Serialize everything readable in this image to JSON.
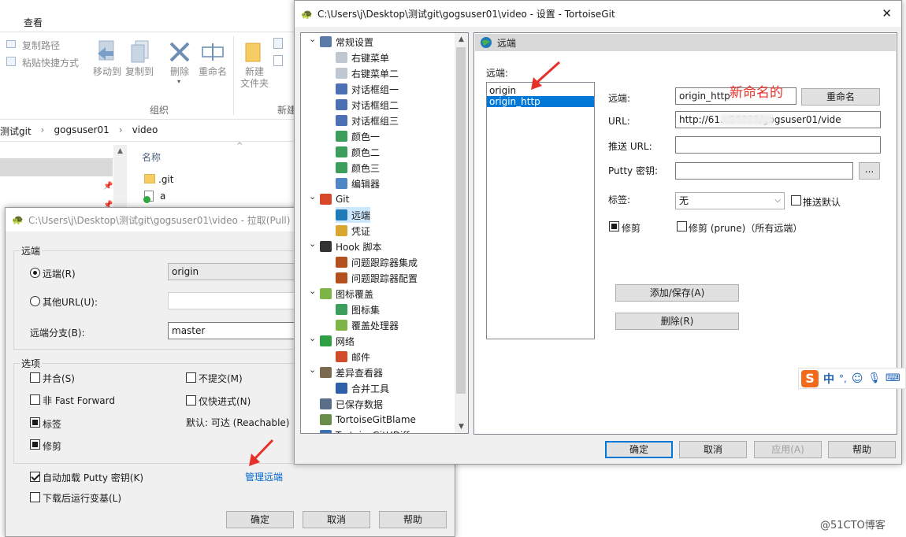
{
  "explorer": {
    "view_tab": "查看",
    "copy_path": "复制路径",
    "paste_shortcut": "粘贴快捷方式",
    "move_to": "移动到",
    "copy_to": "复制到",
    "delete": "删除",
    "rename": "重命名",
    "new_folder": "新建\n文件夹",
    "organize_group": "组织",
    "new_group": "新建",
    "breadcrumb": [
      "测试git",
      "gogsuser01",
      "video"
    ],
    "column_name": "名称",
    "files": [
      ".git",
      "a"
    ]
  },
  "pull_dialog": {
    "title": "C:\\Users\\j\\Desktop\\测试git\\gogsuser01\\video - 拉取(Pull) -",
    "remote_group": "远端",
    "remote_radio": "远端(R)",
    "remote_value": "origin",
    "other_url_radio": "其他URL(U):",
    "other_url_value": "",
    "remote_branch_label": "远端分支(B):",
    "remote_branch_value": "master",
    "options_group": "选项",
    "merge": "并合(S)",
    "no_commit": "不提交(M)",
    "non_ff": "非 Fast Forward",
    "ff_only": "仅快进式(N)",
    "tags": "标签",
    "default_reachable": "默认: 可达 (Reachable)",
    "prune": "修剪",
    "autoload_putty": "自动加载 Putty 密钥(K)",
    "manage_remotes": "管理远端",
    "launch_rebase": "下载后运行变基(L)",
    "ok": "确定",
    "cancel": "取消",
    "help": "帮助"
  },
  "settings_dialog": {
    "title": "C:\\Users\\j\\Desktop\\测试git\\gogsuser01\\video - 设置 - TortoiseGit",
    "close_glyph": "✕",
    "tree": [
      {
        "label": "常规设置",
        "level": 0,
        "icon": "wrench-icon"
      },
      {
        "label": "右键菜单",
        "level": 1,
        "icon": "gear-icon"
      },
      {
        "label": "右键菜单二",
        "level": 1,
        "icon": "gear-icon"
      },
      {
        "label": "对话框组一",
        "level": 1,
        "icon": "dialog-icon"
      },
      {
        "label": "对话框组二",
        "level": 1,
        "icon": "dialog-icon"
      },
      {
        "label": "对话框组三",
        "level": 1,
        "icon": "dialog-icon"
      },
      {
        "label": "颜色一",
        "level": 1,
        "icon": "color-icon"
      },
      {
        "label": "颜色二",
        "level": 1,
        "icon": "color-icon"
      },
      {
        "label": "颜色三",
        "level": 1,
        "icon": "color-icon"
      },
      {
        "label": "编辑器",
        "level": 1,
        "icon": "editor-icon"
      },
      {
        "label": "Git",
        "level": 0,
        "icon": "git-icon"
      },
      {
        "label": "远端",
        "level": 1,
        "icon": "globe-icon",
        "selected": true
      },
      {
        "label": "凭证",
        "level": 1,
        "icon": "credential-icon"
      },
      {
        "label": "Hook 脚本",
        "level": 0,
        "icon": "hook-icon"
      },
      {
        "label": "问题跟踪器集成",
        "level": 1,
        "icon": "bug-icon"
      },
      {
        "label": "问题跟踪器配置",
        "level": 1,
        "icon": "bug-icon"
      },
      {
        "label": "图标覆盖",
        "level": 0,
        "icon": "overlay-icon"
      },
      {
        "label": "图标集",
        "level": 1,
        "icon": "color-icon"
      },
      {
        "label": "覆盖处理器",
        "level": 1,
        "icon": "overlay-icon"
      },
      {
        "label": "网络",
        "level": 0,
        "icon": "network-icon"
      },
      {
        "label": "邮件",
        "level": 1,
        "icon": "mail-icon"
      },
      {
        "label": "差异查看器",
        "level": 0,
        "icon": "diff-icon"
      },
      {
        "label": "合并工具",
        "level": 1,
        "icon": "merge-icon"
      },
      {
        "label": "已保存数据",
        "level": 0,
        "icon": "saved-data-icon"
      },
      {
        "label": "TortoiseGitBlame",
        "level": 0,
        "icon": "blame-icon"
      },
      {
        "label": "TortoiseGitUDiff",
        "level": 0,
        "icon": "udiff-icon"
      }
    ],
    "page_header": "远端",
    "remotes_label": "远端:",
    "remotes": [
      "origin",
      "origin_http"
    ],
    "selected_remote": "origin_http",
    "remote_field_label": "远端:",
    "remote_field_value": "origin_http",
    "rename_button": "重命名",
    "url_label": "URL:",
    "url_value": "http://61.          :20891/gogsuser01/vide",
    "push_url_label": "推送 URL:",
    "push_url_value": "",
    "putty_label": "Putty 密钥:",
    "putty_value": "",
    "browse": "...",
    "tags_label": "标签:",
    "tags_value": "无",
    "push_default": "推送默认",
    "prune_label": "修剪",
    "prune_all": "修剪 (prune)（所有远端）",
    "add_save": "添加/保存(A)",
    "remove": "删除(R)",
    "ok": "确定",
    "cancel": "取消",
    "apply": "应用(A)",
    "help": "帮助"
  },
  "annotation": {
    "renamed_note": "新命名的"
  },
  "ime_toolbar": {
    "logo": "S",
    "mode": "中",
    "punct": "°,"
  },
  "watermark": "@51CTO博客",
  "colors": {
    "selection": "#0078d7",
    "annotation_red": "#e8302a",
    "link_blue": "#0066cc",
    "ime_orange": "#f26b1d"
  }
}
